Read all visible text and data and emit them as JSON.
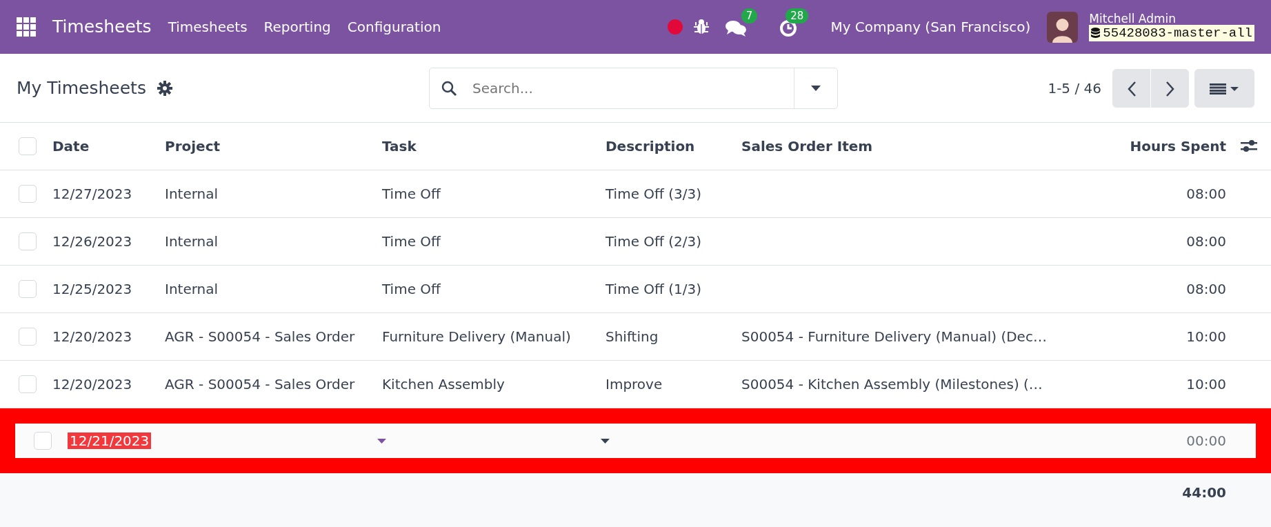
{
  "navbar": {
    "app_name": "Timesheets",
    "menu": [
      "Timesheets",
      "Reporting",
      "Configuration"
    ],
    "messages_count": "7",
    "activities_count": "28",
    "company": "My Company (San Francisco)",
    "user": "Mitchell Admin",
    "database": "55428083-master-all"
  },
  "control_panel": {
    "title": "My Timesheets",
    "search": {
      "placeholder": "Search..."
    },
    "pager": "1-5 / 46"
  },
  "table": {
    "select_all_checked": false,
    "columns": [
      "Date",
      "Project",
      "Task",
      "Description",
      "Sales Order Item",
      "Hours Spent"
    ],
    "rows": [
      {
        "checked": false,
        "cells": [
          "12/27/2023",
          "Internal",
          "Time Off",
          "Time Off (3/3)",
          "",
          "08:00"
        ]
      },
      {
        "checked": false,
        "cells": [
          "12/26/2023",
          "Internal",
          "Time Off",
          "Time Off (2/3)",
          "",
          "08:00"
        ]
      },
      {
        "checked": false,
        "cells": [
          "12/25/2023",
          "Internal",
          "Time Off",
          "Time Off (1/3)",
          "",
          "08:00"
        ]
      },
      {
        "checked": false,
        "cells": [
          "12/20/2023",
          "AGR - S00054 - Sales Order",
          "Furniture Delivery (Manual)",
          "Shifting",
          "S00054 - Furniture Delivery (Manual) (Dec…",
          "10:00"
        ]
      },
      {
        "checked": false,
        "cells": [
          "12/20/2023",
          "AGR - S00054 - Sales Order",
          "Kitchen Assembly",
          "Improve",
          "S00054 - Kitchen Assembly (Milestones) (…",
          "10:00"
        ]
      }
    ],
    "new_row": {
      "checked": false,
      "date": "12/21/2023",
      "date_selected": true,
      "hours": "00:00"
    },
    "total": "44:00"
  }
}
